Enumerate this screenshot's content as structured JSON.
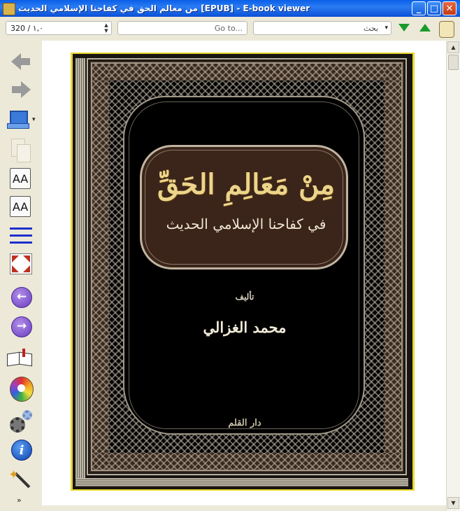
{
  "window": {
    "title": "من معالم الحق في كفاحنا الإسلامي الحديث [EPUB] - E-book viewer",
    "minimize_glyph": "_",
    "maximize_glyph": "□",
    "close_glyph": "✕"
  },
  "toolbar": {
    "page_position": "320 / ١,٠",
    "goto_placeholder": "Go to...",
    "search_value": "بحث",
    "search_dropdown_glyph": "▾",
    "next_match_icon": "triangle-down-icon",
    "prev_match_icon": "triangle-up-icon"
  },
  "sidebar": {
    "font_larger_label": "AA",
    "font_smaller_label": "AA",
    "prev_page_glyph": "←",
    "next_page_glyph": "→",
    "info_glyph": "i",
    "more_glyph": "»"
  },
  "cover": {
    "title": "مِنْ مَعَالِمِ الحَقِّ",
    "subtitle": "في كفاحنا الإسلامي الحديث",
    "author_label": "تأليف",
    "author": "محمد الغزالي",
    "publisher_mark": "دار القلم"
  },
  "scrollbar": {
    "up_glyph": "▲",
    "down_glyph": "▼"
  },
  "colors": {
    "titlebar": "#0a5fe8",
    "cover_bg": "#171412",
    "title_box": "#3b2419",
    "title_text": "#ecd48a",
    "cover_edge": "#e8d830",
    "nav_arrows": "#1a9a2a"
  }
}
